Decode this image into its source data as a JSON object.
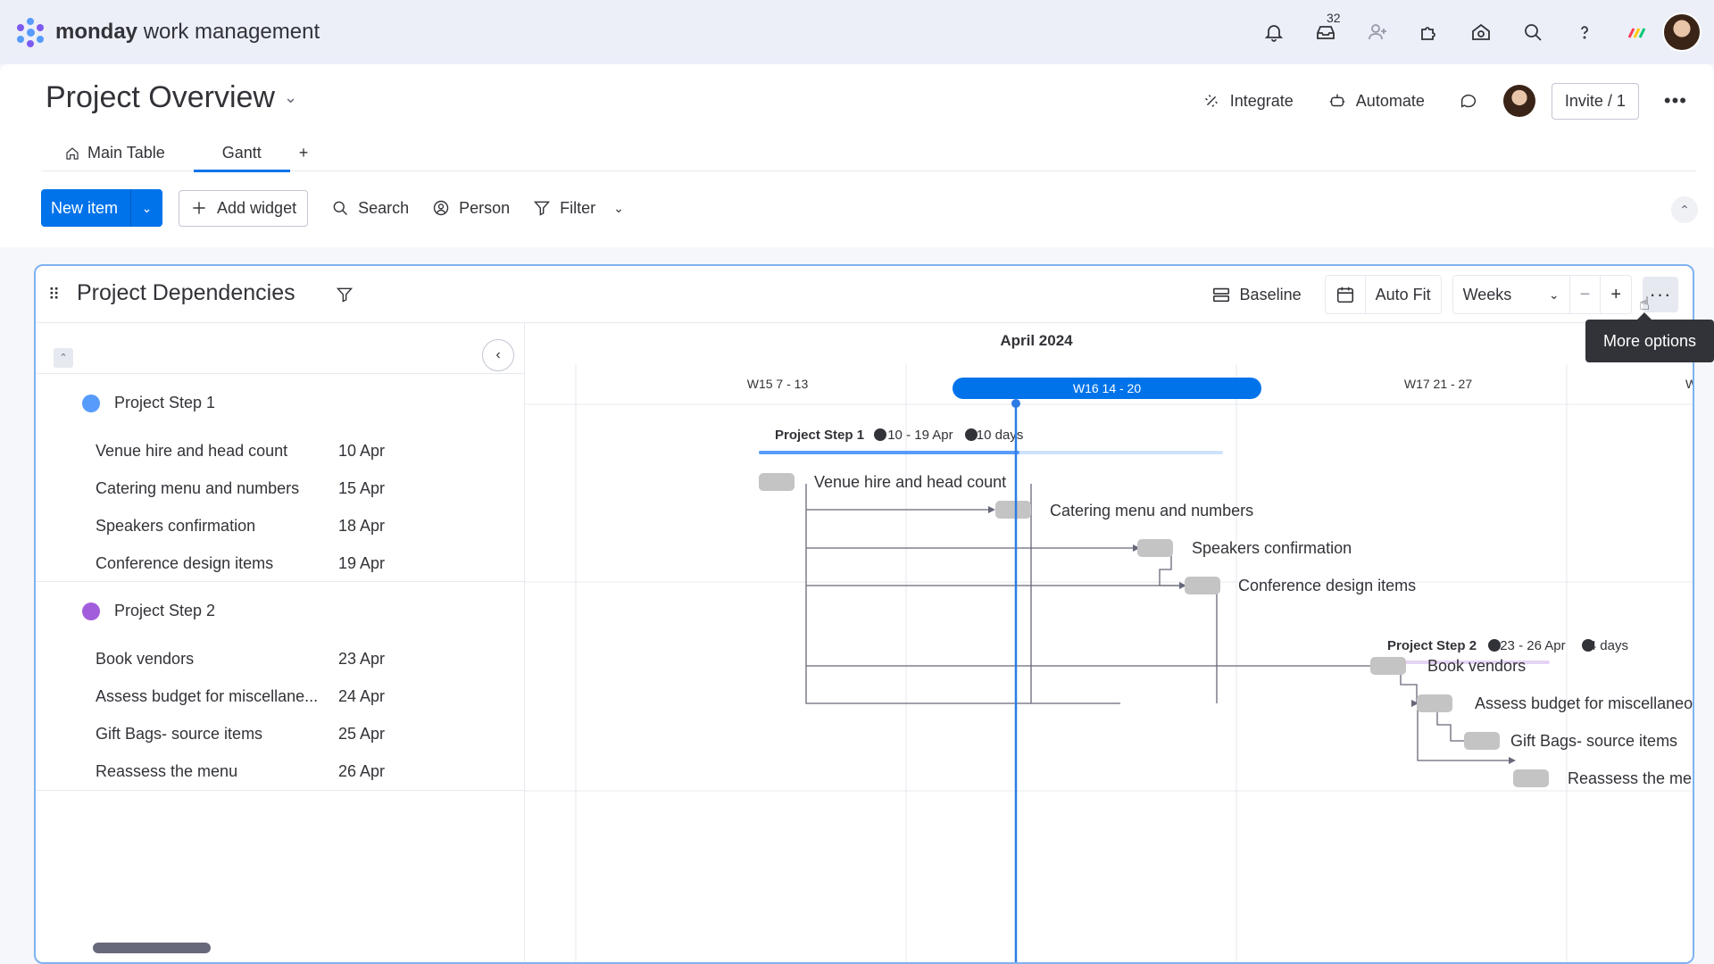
{
  "app": {
    "brand_bold": "monday",
    "brand_rest": "work management",
    "inbox_count": "32"
  },
  "header": {
    "title": "Project Overview",
    "integrate": "Integrate",
    "automate": "Automate",
    "invite": "Invite / 1"
  },
  "tabs": [
    {
      "label": "Main Table"
    },
    {
      "label": "Gantt"
    }
  ],
  "tab_add": "+",
  "toolbar": {
    "new_item": "New item",
    "add_widget": "Add widget",
    "search": "Search",
    "person": "Person",
    "filter": "Filter"
  },
  "widget": {
    "title": "Project Dependencies",
    "baseline": "Baseline",
    "auto_fit": "Auto Fit",
    "scale": "Weeks",
    "tooltip": "More options"
  },
  "timeline": {
    "month": "April 2024",
    "weeks": [
      {
        "label": "W15 7 - 13"
      },
      {
        "label": "W16 14 - 20",
        "current": true
      },
      {
        "label": "W17 21 - 27"
      },
      {
        "label": "W"
      }
    ]
  },
  "groups": [
    {
      "name": "Project Step 1",
      "color": "#579bfc",
      "summary_name": "Project Step 1",
      "summary_range": "10 - 19 Apr",
      "summary_duration": "10 days",
      "items": [
        {
          "name": "Venue hire and head count",
          "date": "10 Apr"
        },
        {
          "name": "Catering menu and numbers",
          "date": "15 Apr"
        },
        {
          "name": "Speakers confirmation",
          "date": "18 Apr"
        },
        {
          "name": "Conference design items",
          "date": "19 Apr"
        }
      ]
    },
    {
      "name": "Project Step 2",
      "color": "#a25ddc",
      "summary_name": "Project Step 2",
      "summary_range": "23 - 26 Apr",
      "summary_duration": "4 days",
      "items": [
        {
          "name": "Book vendors",
          "date": "23 Apr"
        },
        {
          "name": "Assess budget for miscellaneous",
          "display_name": "Assess budget for miscellane...",
          "date": "24 Apr"
        },
        {
          "name": "Gift Bags- source items",
          "date": "25 Apr"
        },
        {
          "name": "Reassess the menu",
          "date": "26 Apr"
        }
      ]
    }
  ],
  "colors": {
    "accent": "#0073ea",
    "today_line": "#2c7be5",
    "task_bar": "#c4c4c4"
  }
}
